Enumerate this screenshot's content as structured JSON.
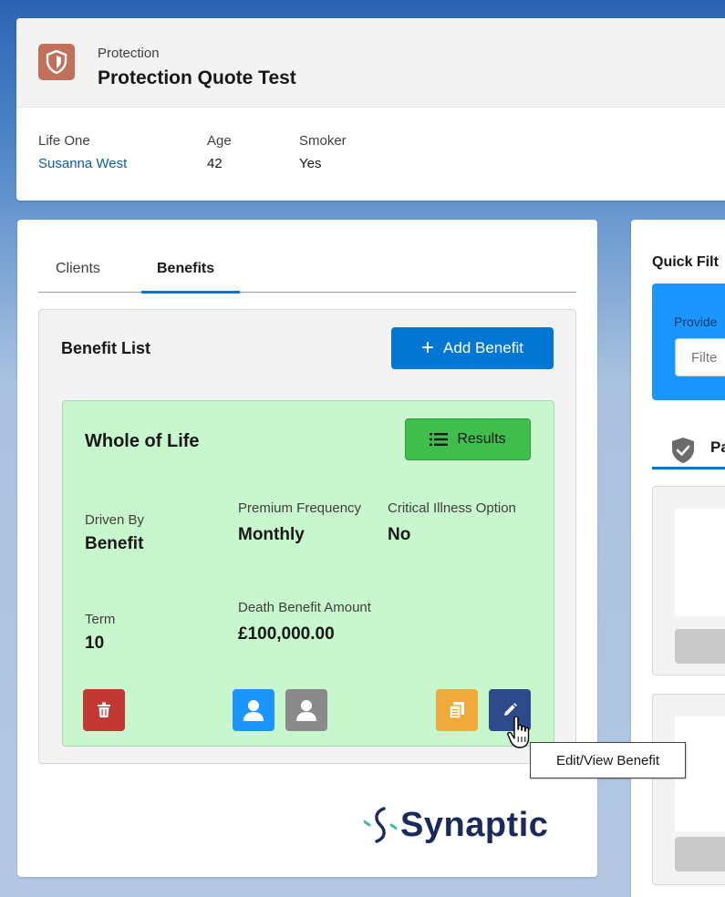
{
  "colors": {
    "brand_blue": "#0176d3",
    "card_green": "#c9f7cd",
    "results_green": "#3fbd4d",
    "delete_red": "#c23934",
    "person_blue": "#1b96ff",
    "person_grey": "#8a8a8a",
    "copy_orange": "#f0a93b",
    "edit_navy": "#2e4a8a",
    "object_icon": "#c2705a"
  },
  "header": {
    "object_type": "Protection",
    "title": "Protection Quote Test",
    "icon": "shield-icon",
    "fields": [
      {
        "label": "Life One",
        "value": "Susanna West"
      },
      {
        "label": "Age",
        "value": "42"
      },
      {
        "label": "Smoker",
        "value": "Yes"
      }
    ]
  },
  "tabs": [
    {
      "label": "Clients",
      "active": false
    },
    {
      "label": "Benefits",
      "active": true
    }
  ],
  "benefit_list": {
    "title": "Benefit List",
    "add_button_label": "Add Benefit"
  },
  "benefit": {
    "title": "Whole of Life",
    "results_label": "Results",
    "fields": {
      "driven_by": {
        "label": "Driven By",
        "value": "Benefit"
      },
      "premium_frequency": {
        "label": "Premium Frequency",
        "value": "Monthly"
      },
      "critical_illness": {
        "label": "Critical Illness Option",
        "value": "No"
      },
      "term": {
        "label": "Term",
        "value": "10"
      },
      "death_benefit": {
        "label": "Death Benefit Amount",
        "value": "£100,000.00"
      }
    }
  },
  "tooltip": "Edit/View Benefit",
  "logo_text": "Synaptic",
  "right_panel": {
    "title": "Quick Filt",
    "provider_label": "Provide",
    "filter_placeholder": "Filte",
    "tab_label": "Pa"
  }
}
